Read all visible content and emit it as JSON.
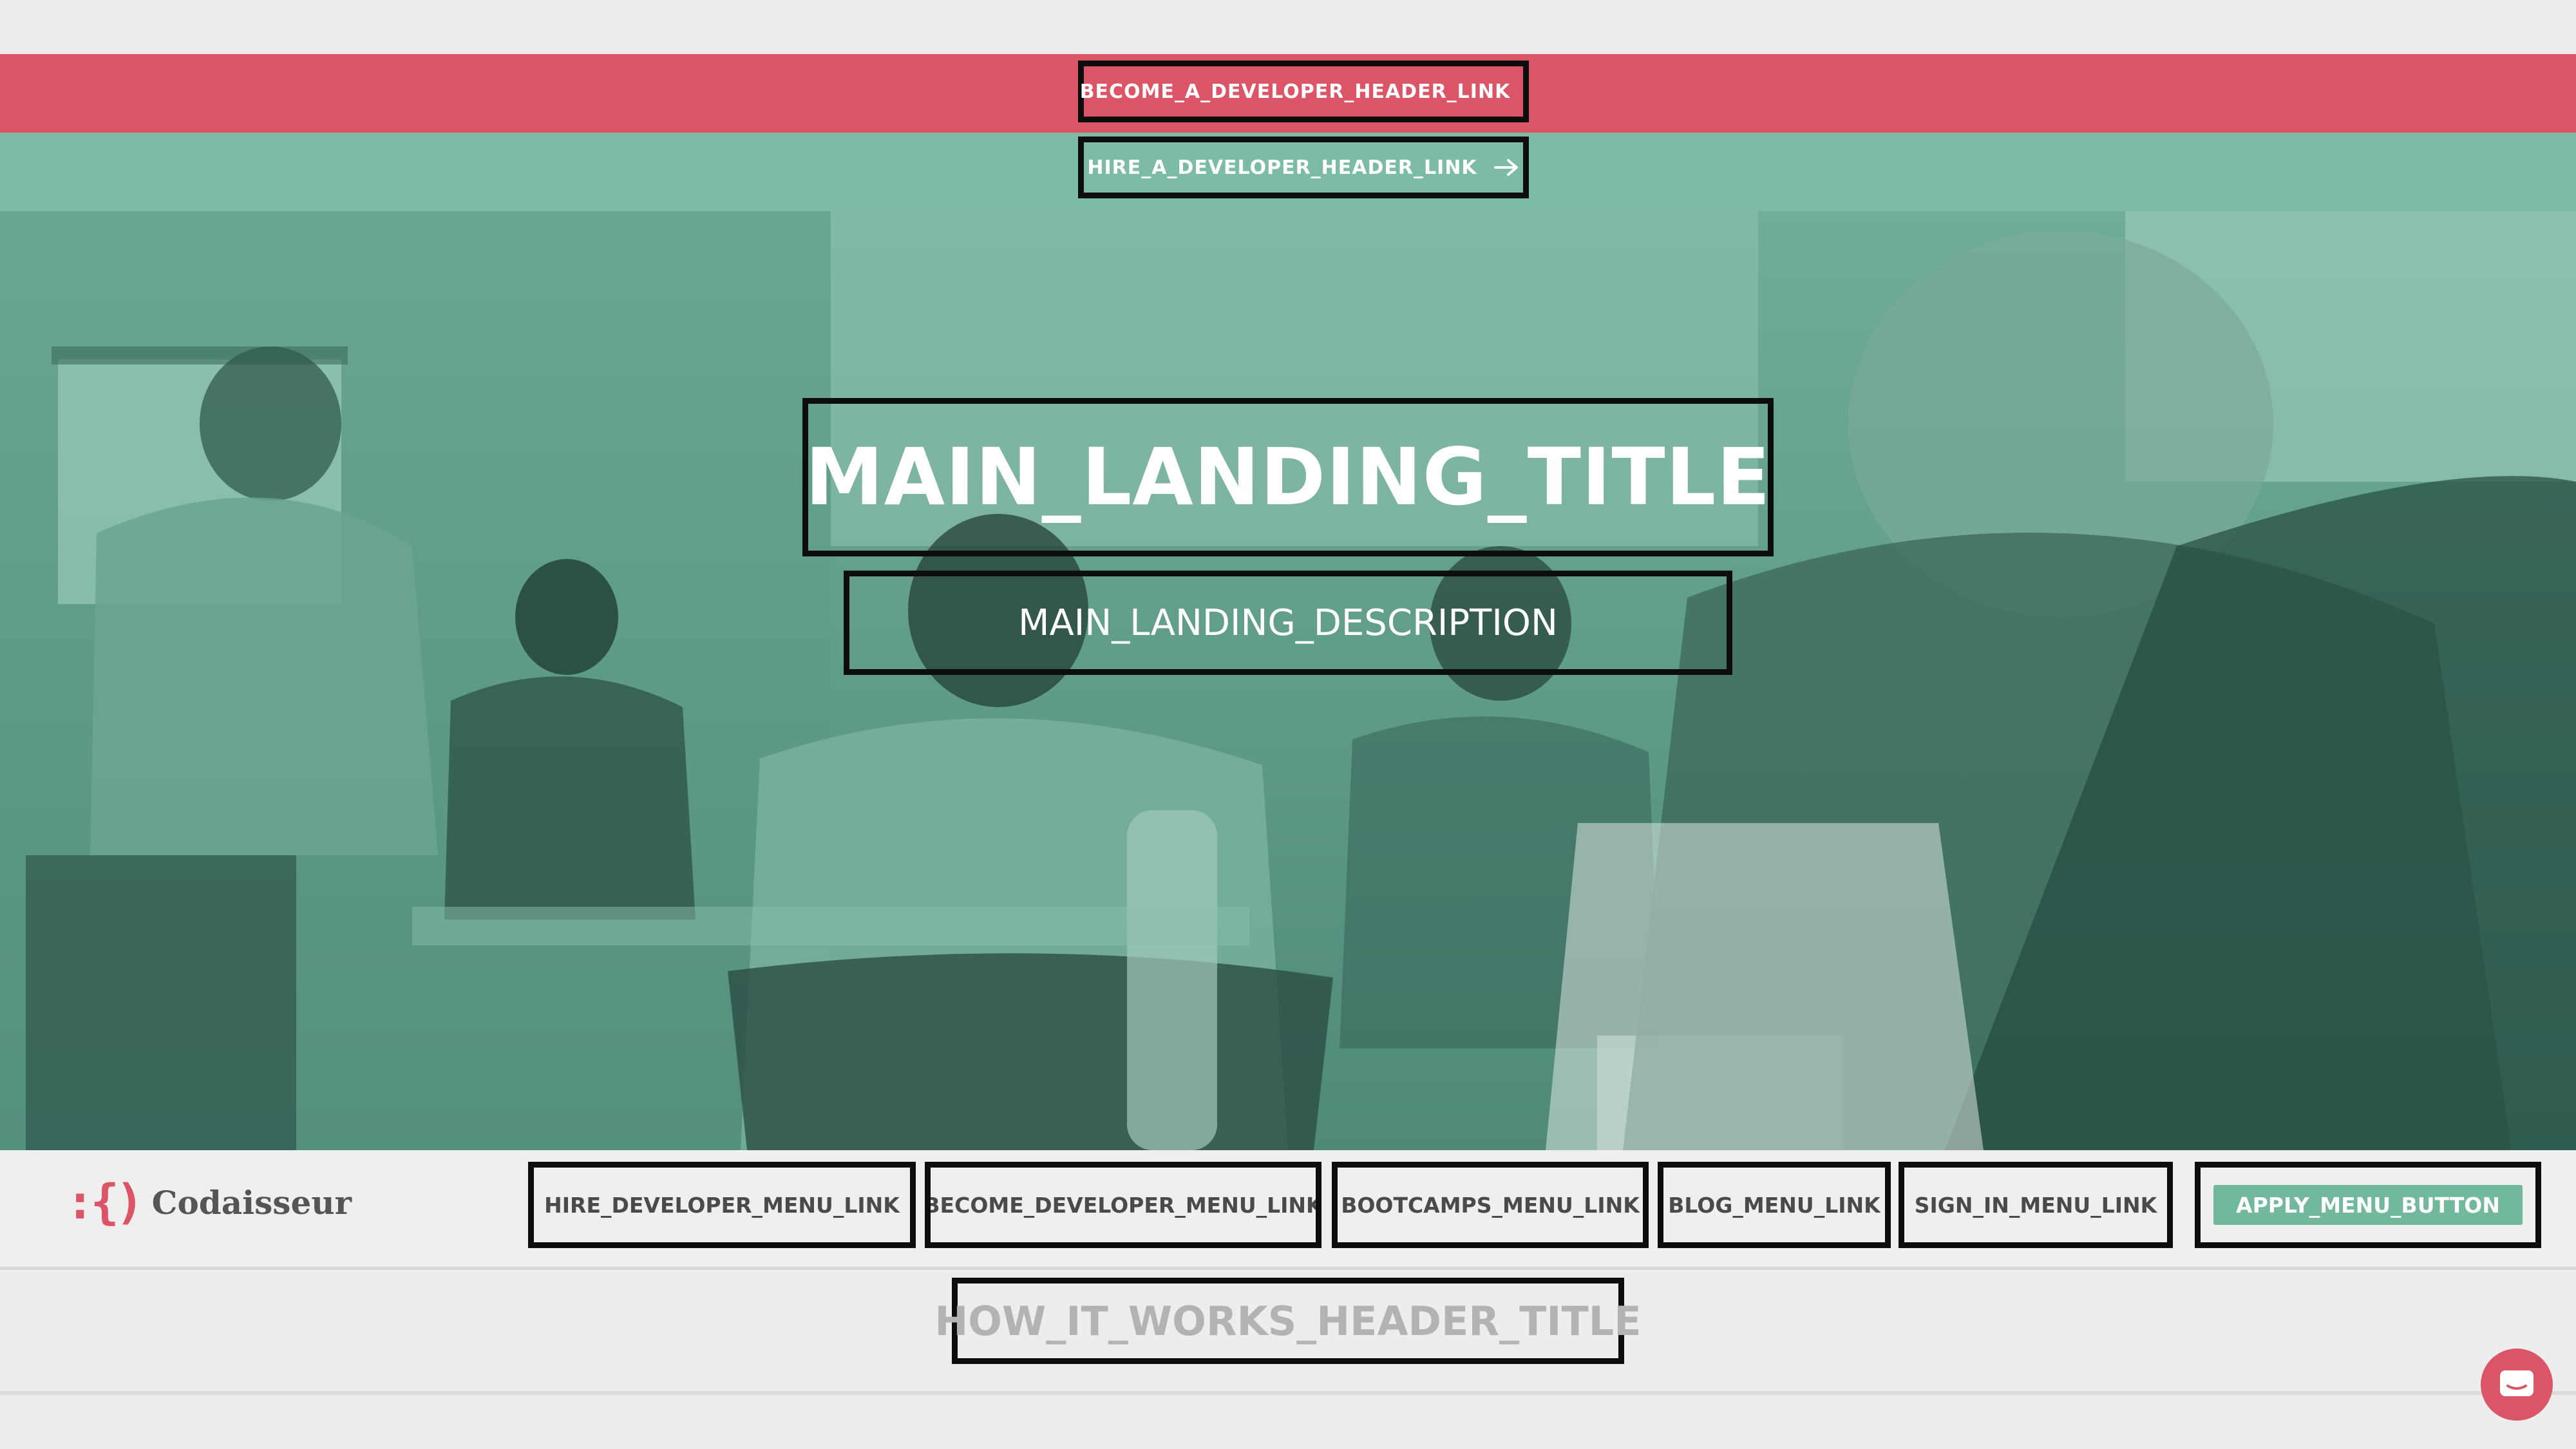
{
  "header": {
    "become_developer_link": "BECOME_A_DEVELOPER_HEADER_LINK",
    "hire_developer_link": "HIRE_A_DEVELOPER_HEADER_LINK"
  },
  "hero": {
    "title": "MAIN_LANDING_TITLE",
    "description": "MAIN_LANDING_DESCRIPTION"
  },
  "logo": {
    "mark": ":{)",
    "text": "Codaisseur"
  },
  "menu": {
    "items": [
      "HIRE_DEVELOPER_MENU_LINK",
      "BECOME_DEVELOPER_MENU_LINK",
      "BOOTCAMPS_MENU_LINK",
      "BLOG_MENU_LINK",
      "SIGN_IN_MENU_LINK"
    ],
    "apply_button": "APPLY_MENU_BUTTON"
  },
  "how_it_works": {
    "title": "HOW_IT_WORKS_HEADER_TITLE"
  },
  "colors": {
    "brand_red": "#db5567",
    "brand_green": "#7cbba5",
    "button_green": "#72b89c"
  },
  "icons": [
    "arrow-right-icon",
    "chat-icon"
  ]
}
